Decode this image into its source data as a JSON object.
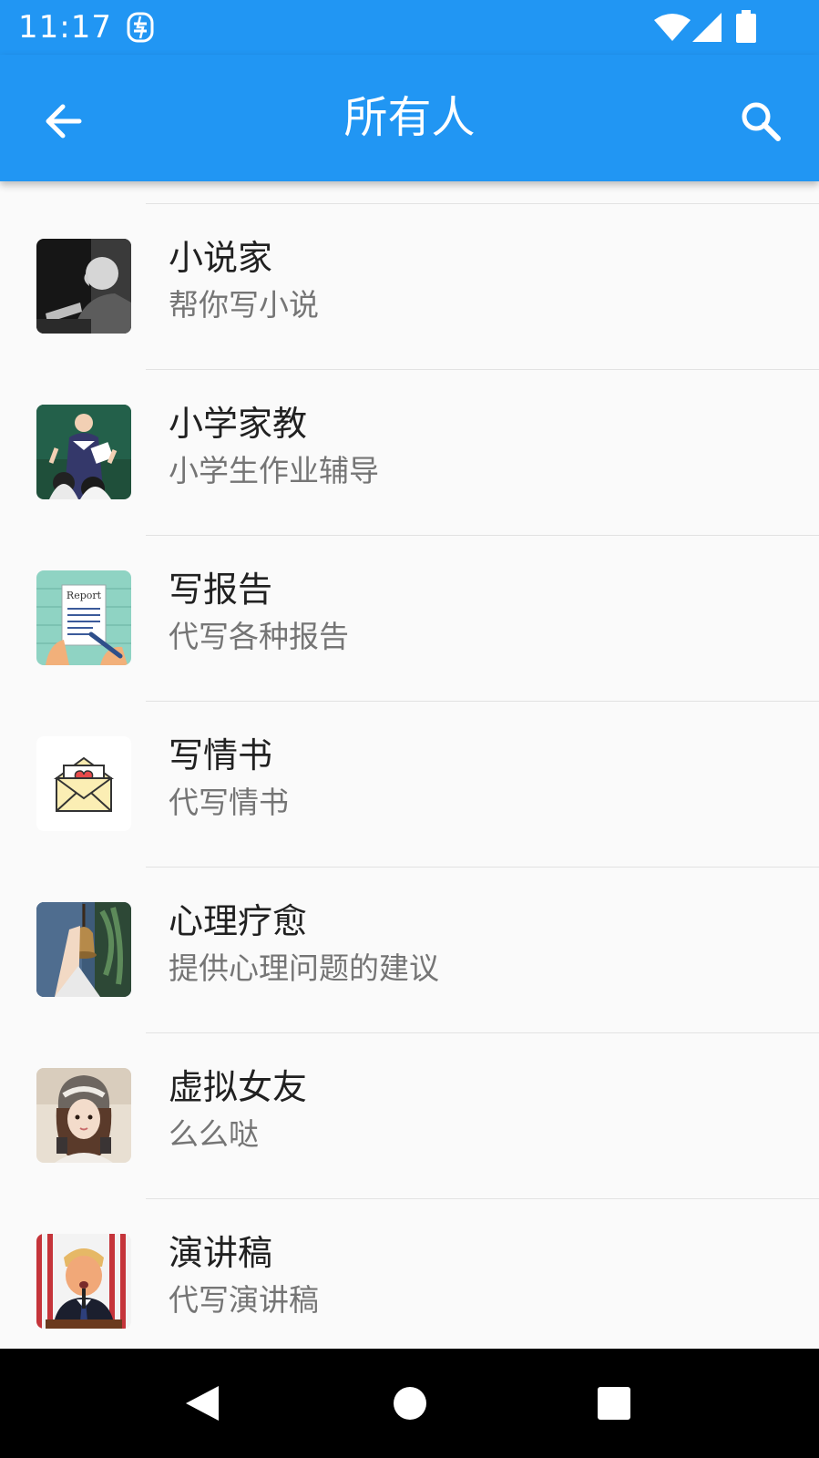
{
  "status_bar": {
    "time": "11:17",
    "icons": [
      "app-notification-icon",
      "wifi-icon",
      "signal-icon",
      "battery-icon"
    ]
  },
  "app_bar": {
    "title": "所有人",
    "back_icon": "arrow-back-icon",
    "search_icon": "search-icon",
    "background": "#2196f3"
  },
  "list": {
    "items": [
      {
        "title": "小说家",
        "subtitle": "帮你写小说",
        "avatar": "novelist-avatar"
      },
      {
        "title": "小学家教",
        "subtitle": "小学生作业辅导",
        "avatar": "tutor-avatar"
      },
      {
        "title": "写报告",
        "subtitle": "代写各种报告",
        "avatar": "report-avatar",
        "avatar_text": "Report"
      },
      {
        "title": "写情书",
        "subtitle": "代写情书",
        "avatar": "love-letter-avatar"
      },
      {
        "title": "心理疗愈",
        "subtitle": "提供心理问题的建议",
        "avatar": "therapy-avatar"
      },
      {
        "title": "虚拟女友",
        "subtitle": "么么哒",
        "avatar": "girlfriend-avatar"
      },
      {
        "title": "演讲稿",
        "subtitle": "代写演讲稿",
        "avatar": "speech-avatar"
      }
    ]
  },
  "nav_bar": {
    "buttons": [
      "back-triangle-icon",
      "home-circle-icon",
      "recents-square-icon"
    ]
  }
}
